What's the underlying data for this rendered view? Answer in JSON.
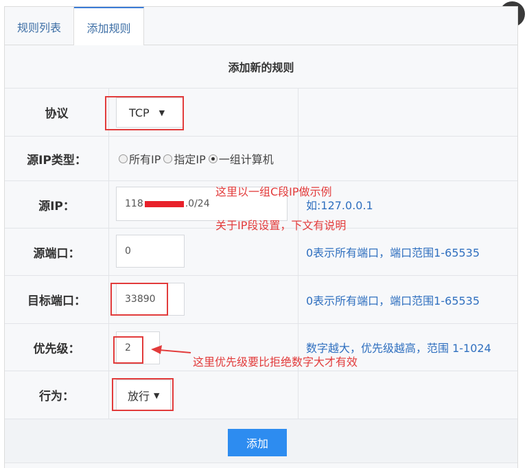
{
  "tabs": [
    {
      "label": "规则列表"
    },
    {
      "label": "添加规则"
    }
  ],
  "form": {
    "title": "添加新的规则",
    "protocol": {
      "label": "协议",
      "value": "TCP"
    },
    "source_ip_type": {
      "label": "源IP类型：",
      "options": [
        {
          "label": "所有IP",
          "checked": false
        },
        {
          "label": "指定IP",
          "checked": false
        },
        {
          "label": "一组计算机",
          "checked": true
        }
      ]
    },
    "source_ip": {
      "label": "源IP：",
      "value_prefix": "118",
      "value_suffix": ".0/24",
      "hint": "如:127.0.0.1"
    },
    "source_port": {
      "label": "源端口：",
      "value": "0",
      "hint": "0表示所有端口，端口范围1-65535"
    },
    "target_port": {
      "label": "目标端口：",
      "value": "33890",
      "hint": "0表示所有端口，端口范围1-65535"
    },
    "priority": {
      "label": "优先级：",
      "value": "2",
      "hint": "数字越大，优先级越高，范围 1-1024"
    },
    "action": {
      "label": "行为：",
      "value": "放行"
    },
    "submit_label": "添加"
  },
  "annotations": {
    "ip_note_1": "这里以一组C段IP做示例",
    "ip_note_2": "关于IP段设置，下文有说明",
    "priority_note": "这里优先级要比拒绝数字大才有效"
  },
  "colors": {
    "accent": "#2d8cf0",
    "hint_text": "#2f6fbf",
    "annotation_red": "#e23b3b"
  },
  "icons": {
    "close": "close-icon",
    "caret": "caret-down-icon",
    "arrow": "arrow-left-icon"
  }
}
